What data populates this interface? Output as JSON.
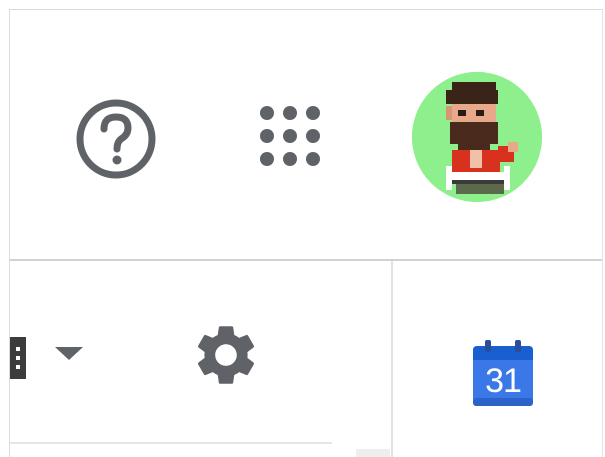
{
  "header": {
    "help_icon": "help-circle-icon",
    "apps_icon": "apps-grid-icon",
    "avatar_icon": "pixel-avatar"
  },
  "toolbar": {
    "view_icon": "view-menu-icon",
    "dropdown_icon": "chevron-down-icon",
    "settings_icon": "gear-icon"
  },
  "side_panel": {
    "calendar_icon": "calendar-icon",
    "calendar_day": "31"
  },
  "colors": {
    "icon_gray": "#5f6368",
    "avatar_bg": "#8ef08c",
    "calendar_blue": "#3b78e7",
    "calendar_dark_blue": "#1a5fd0"
  }
}
